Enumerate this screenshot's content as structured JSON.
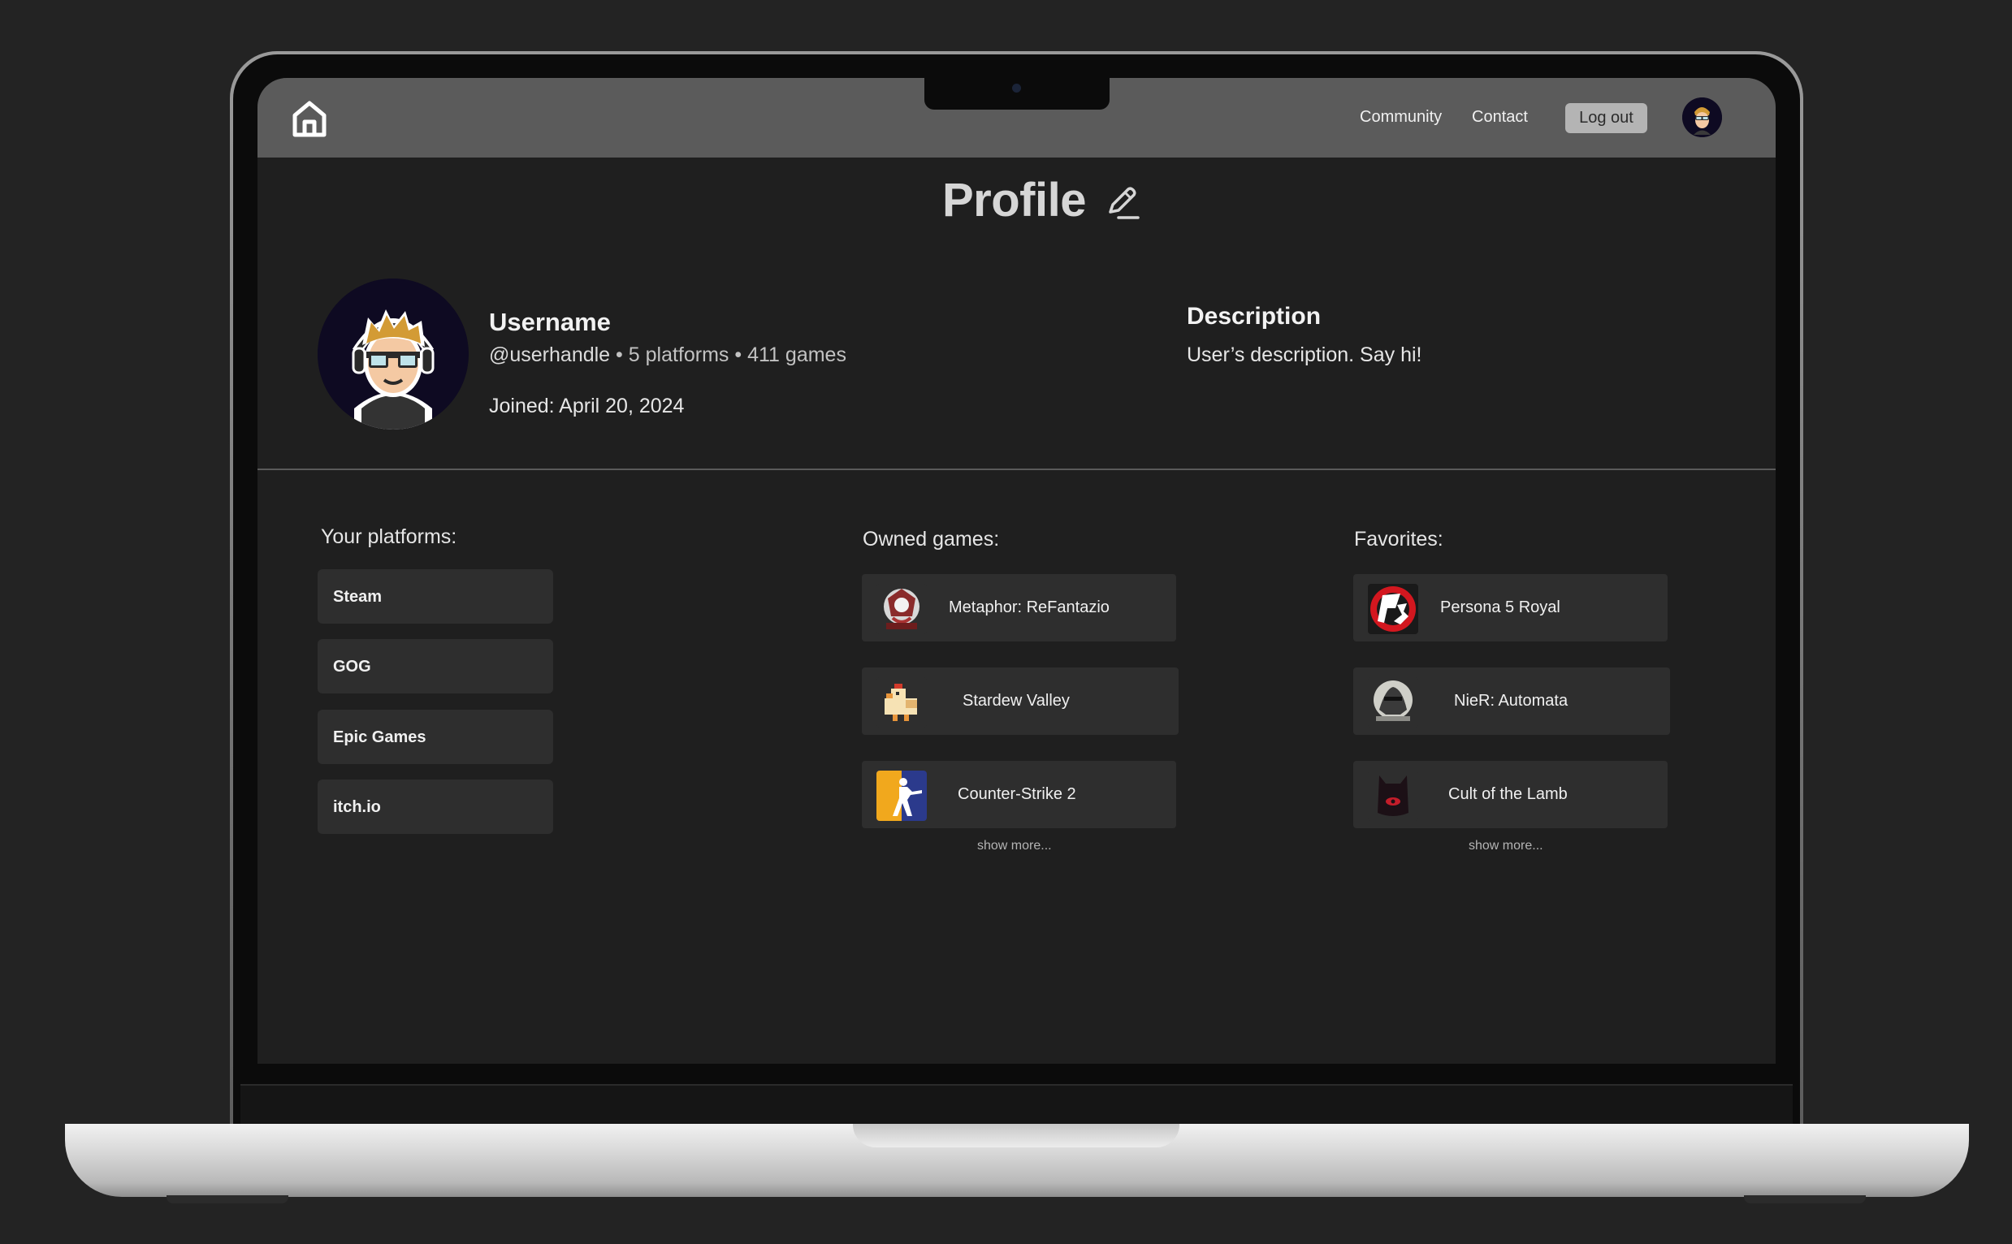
{
  "nav": {
    "community_label": "Community",
    "contact_label": "Contact",
    "logout_label": "Log out"
  },
  "page": {
    "title": "Profile"
  },
  "profile": {
    "username": "Username",
    "handle": "@userhandle",
    "separator": "•",
    "platforms_count": "5 platforms",
    "games_count": "411 games",
    "joined": "Joined: April 20, 2024",
    "description_title": "Description",
    "description_text": "User’s description. Say hi!"
  },
  "platforms": {
    "heading": "Your platforms:",
    "items": [
      {
        "label": "Steam"
      },
      {
        "label": "GOG"
      },
      {
        "label": "Epic Games"
      },
      {
        "label": "itch.io"
      }
    ]
  },
  "owned_games": {
    "heading": "Owned games:",
    "items": [
      {
        "title": "Metaphor: ReFantazio",
        "icon": "metaphor-game-icon"
      },
      {
        "title": "Stardew Valley",
        "icon": "chicken-game-icon"
      },
      {
        "title": "Counter-Strike 2",
        "icon": "counter-strike-icon"
      }
    ],
    "show_more": "show more..."
  },
  "favorites": {
    "heading": "Favorites:",
    "items": [
      {
        "title": "Persona 5 Royal",
        "icon": "persona-game-icon"
      },
      {
        "title": "NieR: Automata",
        "icon": "nier-game-icon"
      },
      {
        "title": "Cult of the Lamb",
        "icon": "cult-lamb-game-icon"
      }
    ],
    "show_more": "show more..."
  },
  "colors": {
    "background": "#232323",
    "screen": "#1f1f1f",
    "navbar": "#5b5b5b",
    "card": "#2e2e2e",
    "logout_button": "#b4b4b4",
    "avatar_bg": "#0e0a22"
  }
}
